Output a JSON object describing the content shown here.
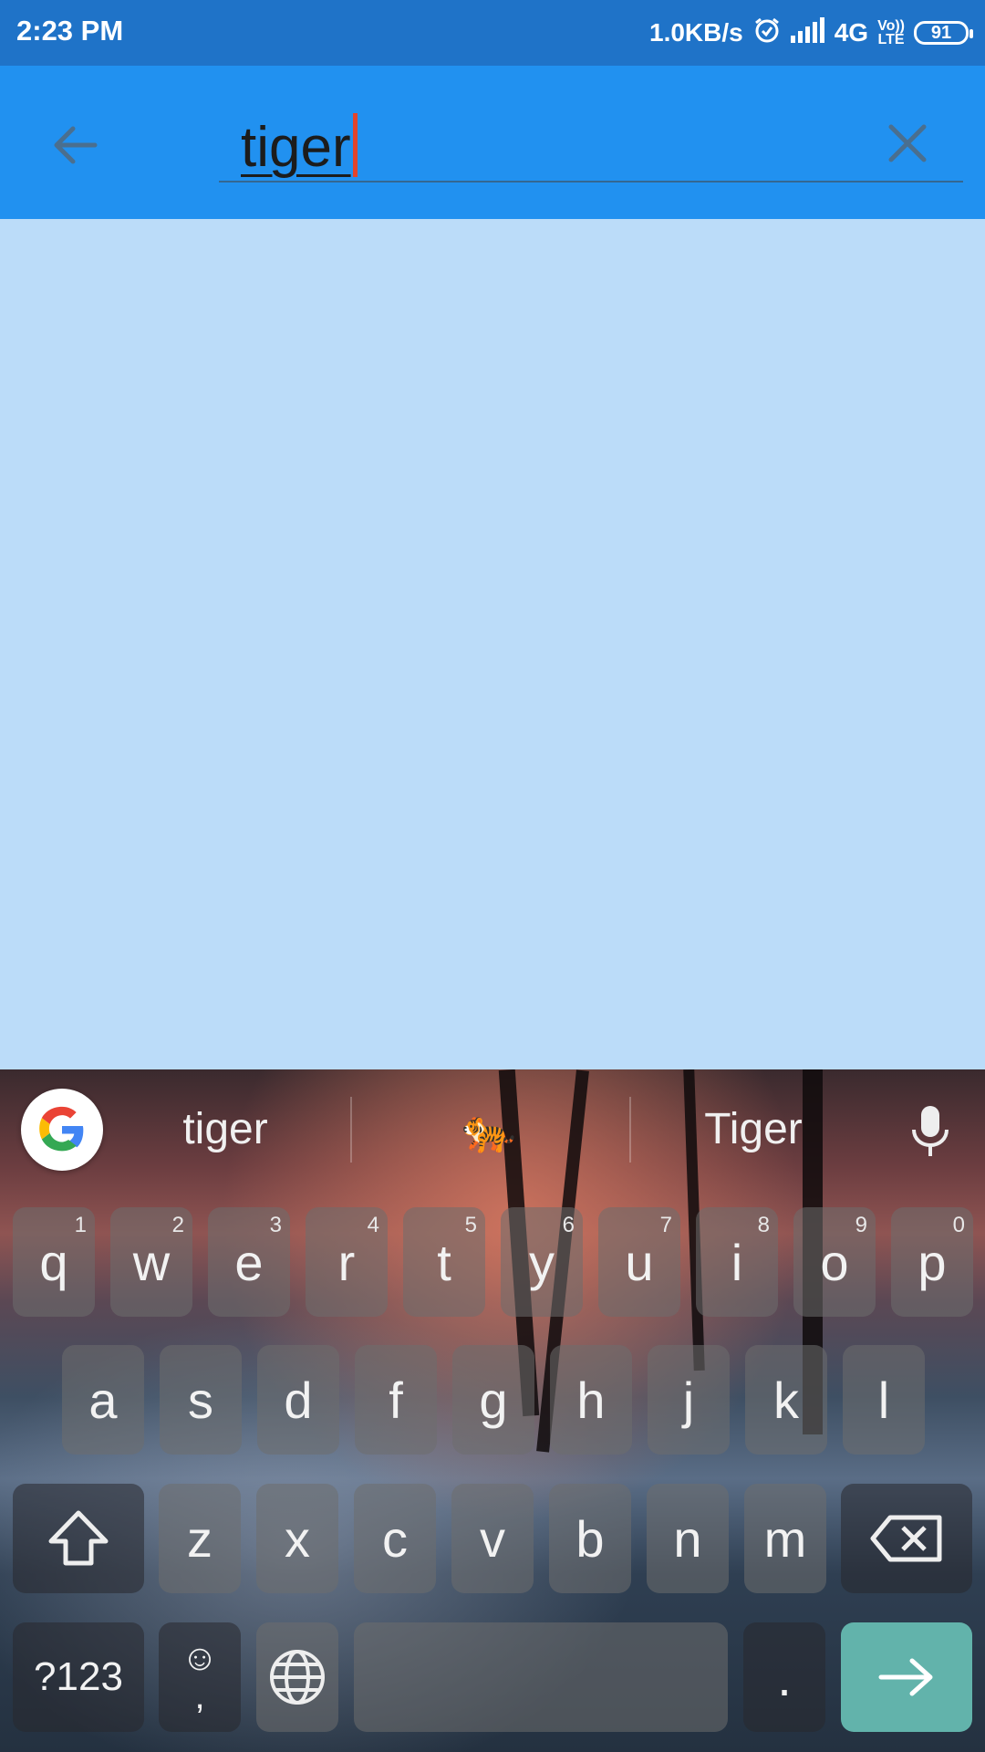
{
  "status_bar": {
    "time": "2:23 PM",
    "speed": "1.0KB/s",
    "network": "4G",
    "volte_top": "Vo))",
    "volte_bottom": "LTE",
    "battery": "91"
  },
  "search": {
    "query": "tiger"
  },
  "keyboard": {
    "suggestions": [
      "tiger",
      "🐅",
      "Tiger"
    ],
    "row1": [
      {
        "l": "q",
        "h": "1"
      },
      {
        "l": "w",
        "h": "2"
      },
      {
        "l": "e",
        "h": "3"
      },
      {
        "l": "r",
        "h": "4"
      },
      {
        "l": "t",
        "h": "5"
      },
      {
        "l": "y",
        "h": "6"
      },
      {
        "l": "u",
        "h": "7"
      },
      {
        "l": "i",
        "h": "8"
      },
      {
        "l": "o",
        "h": "9"
      },
      {
        "l": "p",
        "h": "0"
      }
    ],
    "row2": [
      "a",
      "s",
      "d",
      "f",
      "g",
      "h",
      "j",
      "k",
      "l"
    ],
    "row3": [
      "z",
      "x",
      "c",
      "v",
      "b",
      "n",
      "m"
    ],
    "symbols_label": "?123",
    "emoji_label": "☺",
    "comma_label": ",",
    "period_label": "."
  }
}
